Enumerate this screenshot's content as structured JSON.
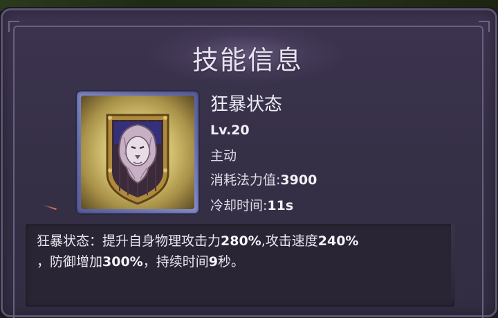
{
  "panel": {
    "title": "技能信息"
  },
  "skill": {
    "icon": "lion-shield-icon",
    "name": "狂暴状态",
    "level": "Lv.20",
    "type": "主动",
    "mana_label": "消耗法力值:",
    "mana_value": "3900",
    "cooldown_label": "冷却时间:",
    "cooldown_value": "11s"
  },
  "description": {
    "prefix": "狂暴状态：提升自身物理攻击力",
    "atk_value": "280%",
    "mid1": ",攻击速度",
    "speed_value": "240%",
    "line2_prefix": "，防御增加",
    "def_value": "300%",
    "mid2": "，持续时间",
    "duration_value": "9",
    "suffix": "秒。"
  },
  "colors": {
    "panel_bg": "#363047",
    "icon_border": "#7f88c9",
    "text": "#ece6f1"
  }
}
